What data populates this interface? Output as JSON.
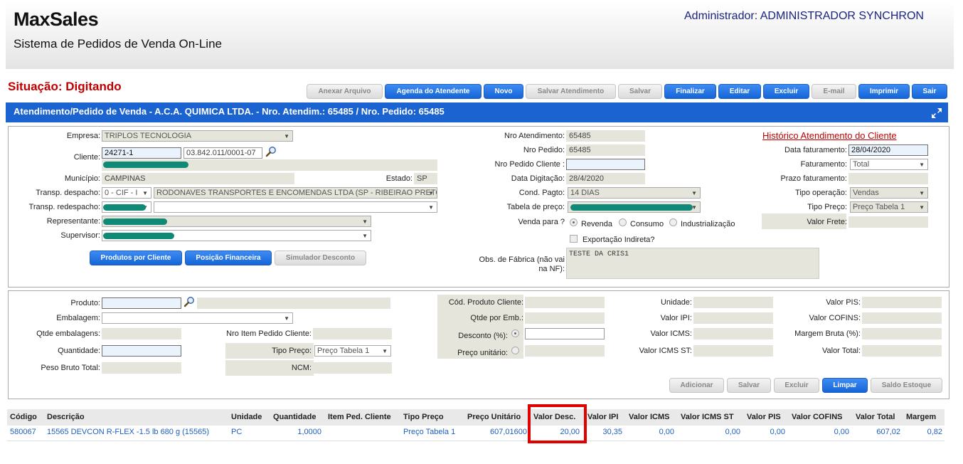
{
  "header": {
    "logo": "MaxSales",
    "subtitle": "Sistema de Pedidos de Venda On-Line",
    "user": "Administrador: ADMINISTRADOR SYNCHRON"
  },
  "status": "Situação: Digitando",
  "toolbar": {
    "anexar": "Anexar Arquivo",
    "agenda": "Agenda do Atendente",
    "novo": "Novo",
    "salvar_atendimento": "Salvar Atendimento",
    "salvar": "Salvar",
    "finalizar": "Finalizar",
    "editar": "Editar",
    "excluir": "Excluir",
    "email": "E-mail",
    "imprimir": "Imprimir",
    "sair": "Sair"
  },
  "title": "Atendimento/Pedido de Venda - A.C.A. QUIMICA LTDA. - Nro. Atendim.: 65485 / Nro. Pedido: 65485",
  "order": {
    "empresa_label": "Empresa:",
    "empresa": "TRIPLOS TECNOLOGIA",
    "cliente_label": "Cliente:",
    "cliente_code": "24271-1",
    "cliente_cnpj": "03.842.011/0001-07",
    "municipio_label": "Município:",
    "municipio": "CAMPINAS",
    "estado_label": "Estado:",
    "estado": "SP",
    "transp_despacho_label": "Transp. despacho:",
    "transp_despacho_tipo": "0 - CIF - I",
    "transp_despacho": "RODONAVES TRANSPORTES E ENCOMENDAS LTDA (SP - RIBEIRAO PRETO)",
    "transp_redespacho_label": "Transp. redespacho:",
    "representante_label": "Representante:",
    "supervisor_label": "Supervisor:",
    "btn_produtos": "Produtos por Cliente",
    "btn_posicao": "Posição Financeira",
    "btn_simulador": "Simulador Desconto",
    "nro_atendimento_label": "Nro Atendimento:",
    "nro_atendimento": "65485",
    "nro_pedido_label": "Nro Pedido:",
    "nro_pedido": "65485",
    "nro_pedido_cliente_label": "Nro Pedido Cliente :",
    "data_digitacao_label": "Data Digitação:",
    "data_digitacao": "28/4/2020",
    "cond_pagto_label": "Cond. Pagto:",
    "cond_pagto": "14 DIAS",
    "tabela_preco_label": "Tabela de preço:",
    "venda_para_label": "Venda para ?",
    "venda_revenda": "Revenda",
    "venda_consumo": "Consumo",
    "venda_industrializacao": "Industrialização",
    "exportacao": "Exportação Indireta?",
    "obs_label": "Obs. de Fábrica (não vai na NF):",
    "obs": "TESTE DA CRIS1",
    "historico_link": "Histórico Atendimento do Cliente",
    "data_faturamento_label": "Data faturamento:",
    "data_faturamento": "28/04/2020",
    "faturamento_label": "Faturamento:",
    "faturamento": "Total",
    "prazo_label": "Prazo faturamento:",
    "tipo_operacao_label": "Tipo operação:",
    "tipo_operacao": "Vendas",
    "tipo_preco_label": "Tipo Preço:",
    "tipo_preco": "Preço Tabela 1",
    "valor_frete_label": "Valor Frete:"
  },
  "item": {
    "produto_label": "Produto:",
    "embalagem_label": "Embalagem:",
    "qtde_embalagens_label": "Qtde embalagens:",
    "nro_item_label": "Nro Item Pedido Cliente:",
    "quantidade_label": "Quantidade:",
    "tipo_preco_label": "Tipo Preço:",
    "tipo_preco": "Preço Tabela 1",
    "peso_label": "Peso Bruto Total:",
    "ncm_label": "NCM:",
    "cod_produto_cliente_label": "Cód. Produto Cliente:",
    "qtde_por_emb_label": "Qtde por Emb.:",
    "desconto_label": "Desconto (%):",
    "preco_unitario_label": "Preço unitário:",
    "unidade_label": "Unidade:",
    "valor_ipi_label": "Valor IPI:",
    "valor_icms_label": "Valor ICMS:",
    "valor_icms_st_label": "Valor ICMS ST:",
    "valor_pis_label": "Valor PIS:",
    "valor_cofins_label": "Valor COFINS:",
    "margem_label": "Margem Bruta (%):",
    "valor_total_label": "Valor Total:",
    "btn_adicionar": "Adicionar",
    "btn_salvar": "Salvar",
    "btn_excluir": "Excluir",
    "btn_limpar": "Limpar",
    "btn_saldo": "Saldo Estoque"
  },
  "grid": {
    "columns": [
      "Código",
      "Descrição",
      "Unidade",
      "Quantidade",
      "Item Ped. Cliente",
      "Tipo Preço",
      "Preço Unitário",
      "Valor Desc.",
      "Valor IPI",
      "Valor ICMS",
      "Valor ICMS ST",
      "Valor PIS",
      "Valor COFINS",
      "Valor Total",
      "Margem"
    ],
    "rows": [
      [
        "580067",
        "15565 DEVCON R-FLEX -1.5 lb 680 g (15565)",
        "PC",
        "1,0000",
        "",
        "Preço Tabela 1",
        "607,01600",
        "20,00",
        "30,35",
        "0,00",
        "0,00",
        "0,00",
        "0,00",
        "607,02",
        "0,82"
      ]
    ]
  },
  "colors": {
    "primary": "#1a63d0",
    "status": "#c00000",
    "highlight": "#e00000",
    "mask": "#0f8a77"
  }
}
